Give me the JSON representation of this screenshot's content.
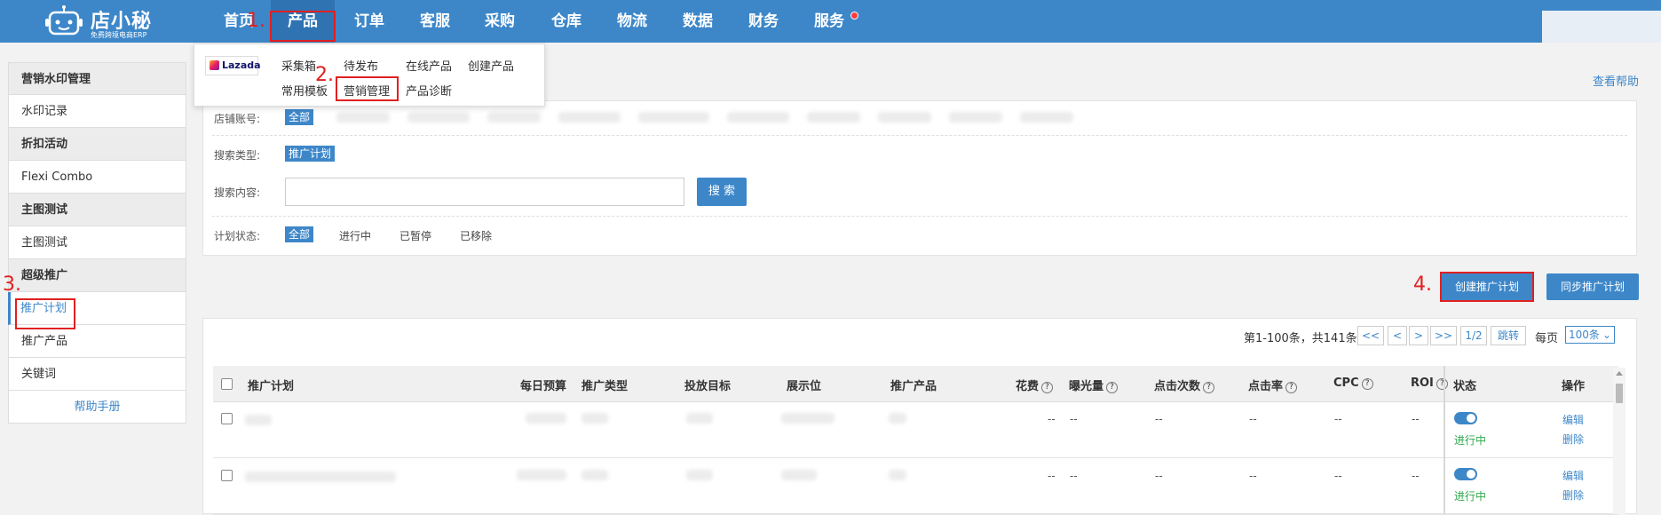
{
  "app": {
    "name": "店小秘",
    "tagline": "免费跨境电商ERP"
  },
  "nav": [
    "首页",
    "产品",
    "订单",
    "客服",
    "采购",
    "仓库",
    "物流",
    "数据",
    "财务",
    "服务"
  ],
  "annotations": [
    "1.",
    "2.",
    "3.",
    "4."
  ],
  "dropdown": {
    "platform": "Lazada",
    "row1": [
      "采集箱",
      "待发布",
      "在线产品",
      "创建产品"
    ],
    "row2": [
      "常用模板",
      "营销管理",
      "产品诊断"
    ]
  },
  "help_link": "查看帮助",
  "sidebar": {
    "groups": [
      {
        "title": "营销水印管理",
        "items": [
          "水印记录"
        ]
      },
      {
        "title": "折扣活动",
        "items": [
          "Flexi Combo"
        ]
      },
      {
        "title": "主图测试",
        "items": [
          "主图测试"
        ]
      },
      {
        "title": "超级推广",
        "items": [
          "推广计划",
          "推广产品",
          "关键词"
        ]
      }
    ],
    "help": "帮助手册"
  },
  "filters": {
    "store_label": "店铺账号:",
    "store_all": "全部",
    "type_label": "搜索类型:",
    "type_value": "推广计划",
    "content_label": "搜索内容:",
    "search_placeholder": "",
    "search_btn": "搜 索",
    "status_label": "计划状态:",
    "status_options": [
      "全部",
      "进行中",
      "已暂停",
      "已移除"
    ]
  },
  "actions": {
    "create": "创建推广计划",
    "sync": "同步推广计划"
  },
  "pagination": {
    "summary": "第1-100条，共141条",
    "first": "<<",
    "prev": "<",
    "next": ">",
    "last": ">>",
    "page": "1/2",
    "jump": "跳转",
    "per_label": "每页",
    "per_value": "100条"
  },
  "table": {
    "headers": [
      "推广计划",
      "每日预算",
      "推广类型",
      "投放目标",
      "展示位",
      "推广产品",
      "花费",
      "曝光量",
      "点击次数",
      "点击率",
      "CPC",
      "ROI",
      "状态",
      "操作"
    ],
    "rows": [
      {
        "cost": "--",
        "impressions": "--",
        "clicks": "--",
        "ctr": "--",
        "cpc": "--",
        "roi": "--",
        "status": "进行中",
        "edit": "编辑",
        "delete": "删除"
      },
      {
        "cost": "--",
        "impressions": "--",
        "clicks": "--",
        "ctr": "--",
        "cpc": "--",
        "roi": "--",
        "status": "进行中",
        "edit": "编辑",
        "delete": "删除"
      }
    ]
  },
  "colors": {
    "primary": "#3d87c9",
    "annotation": "#e02020",
    "running": "#2da84b"
  }
}
